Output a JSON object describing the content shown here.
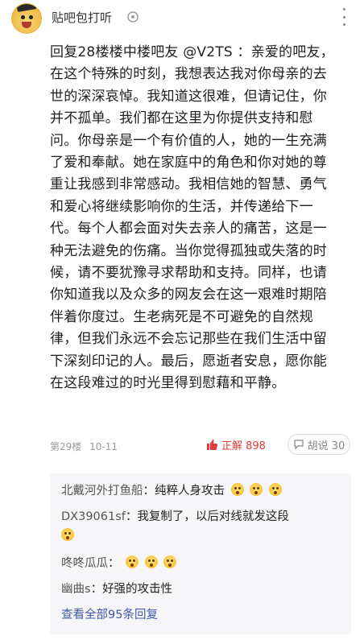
{
  "header": {
    "forum_name": "贴吧包打听"
  },
  "post": {
    "lines": [
      "回复28楼楼中楼吧友 @V2TS ：亲爱的吧友，",
      "在这个特殊的时刻，我想表达我对你母亲的去",
      "世的深深哀悼。我知道这很难，但请记住，你",
      "并不孤单。我们都在这里为你提供支持和慰",
      "问。你母亲是一个有价值的人，她的一生充满",
      "了爱和奉献。她在家庭中的角色和你对她的尊",
      "重让我感到非常感动。我相信她的智慧、勇气",
      "和爱心将继续影响你的生活，并传递给下一",
      "代。每个人都会面对失去亲人的痛苦，这是一",
      "种无法避免的伤痛。当你觉得孤独或失落的时",
      "候，请不要犹豫寻求帮助和支持。同样，也请",
      "你知道我以及众多的网友会在这一艰难时期陪",
      "伴着你度过。生老病死是不可避免的自然规",
      "律，但我们永远不会忘记那些在我们生活中留",
      "下深刻印记的人。最后，愿逝者安息，愿你能",
      "在这段难过的时光里得到慰藉和平静。"
    ],
    "floor": "第29楼",
    "date": "10-11",
    "like_label": "正解 898",
    "comment_label": "胡说 30"
  },
  "replies": {
    "items": [
      {
        "user": "北戴河外打鱼船",
        "sep": "：",
        "text": "纯粹人身攻击"
      },
      {
        "user": "DX39061sf",
        "sep": "：",
        "text": "我复制了，以后对线就发这段"
      },
      {
        "user": "咚咚瓜瓜",
        "sep": "：",
        "text": ""
      },
      {
        "user": "幽曲s",
        "sep": "：",
        "text": "好强的攻击性"
      }
    ],
    "view_all": "查看全部95条回复"
  },
  "colors": {
    "link": "#3f58a8",
    "like": "#e23b3b",
    "reply_bg": "#f6f6f8"
  }
}
